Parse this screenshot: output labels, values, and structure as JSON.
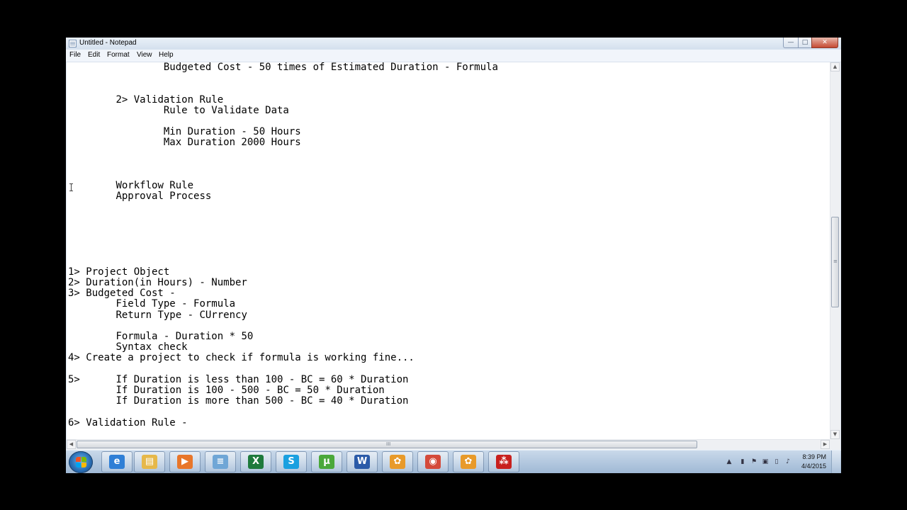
{
  "window": {
    "title": "Untitled - Notepad",
    "min_glyph": "—",
    "max_glyph": "□",
    "close_glyph": "✕"
  },
  "menu": {
    "file": "File",
    "edit": "Edit",
    "format": "Format",
    "view": "View",
    "help": "Help"
  },
  "editor": {
    "text": "\t\tBudgeted Cost - 50 times of Estimated Duration - Formula\n\n\n\t2> Validation Rule\n\t\tRule to Validate Data\n\n\t\tMin Duration - 50 Hours\n\t\tMax Duration 2000 Hours\n\n\n\n\tWorkflow Rule\n\tApproval Process\n\n\n\n\n\n\n1> Project Object\n2> Duration(in Hours) - Number\n3> Budgeted Cost -\n\tField Type - Formula\n\tReturn Type - CUrrency\n\n\tFormula - Duration * 50\n\tSyntax check\n4> Create a project to check if formula is working fine...\n\n5>\tIf Duration is less than 100 - BC = 60 * Duration\n\tIf Duration is 100 - 500 - BC = 50 * Duration\n\tIf Duration is more than 500 - BC = 40 * Duration\n\n6> Validation Rule -"
  },
  "scrollbars": {
    "up_arrow": "▲",
    "down_arrow": "▼",
    "left_arrow": "◀",
    "right_arrow": "▶",
    "grip": "≡",
    "hgrip": "III"
  },
  "taskbar": {
    "start_icon": "windows-orb",
    "pinned": [
      {
        "name": "internet-explorer",
        "glyph": "e",
        "color": "#2f7fd6"
      },
      {
        "name": "windows-explorer",
        "glyph": "▤",
        "color": "#e6b84a"
      },
      {
        "name": "media-player",
        "glyph": "▶",
        "color": "#e8762a"
      },
      {
        "name": "notepad",
        "glyph": "≡",
        "color": "#6fa6d6"
      },
      {
        "name": "excel",
        "glyph": "X",
        "color": "#1e7a3c"
      },
      {
        "name": "skype",
        "glyph": "S",
        "color": "#1aa0e0"
      },
      {
        "name": "utorrent",
        "glyph": "μ",
        "color": "#4aa83a"
      },
      {
        "name": "word",
        "glyph": "W",
        "color": "#2a5aa8"
      },
      {
        "name": "flower-app-1",
        "glyph": "✿",
        "color": "#e89a2a"
      },
      {
        "name": "chrome",
        "glyph": "◉",
        "color": "#d44a3a"
      },
      {
        "name": "flower-app-2",
        "glyph": "✿",
        "color": "#e89a2a"
      },
      {
        "name": "acrobat-reader",
        "glyph": "⁂",
        "color": "#c8201e"
      }
    ],
    "tray": {
      "show_hidden": "▲",
      "clock_time": "8:39 PM",
      "clock_date": "4/4/2015"
    }
  }
}
